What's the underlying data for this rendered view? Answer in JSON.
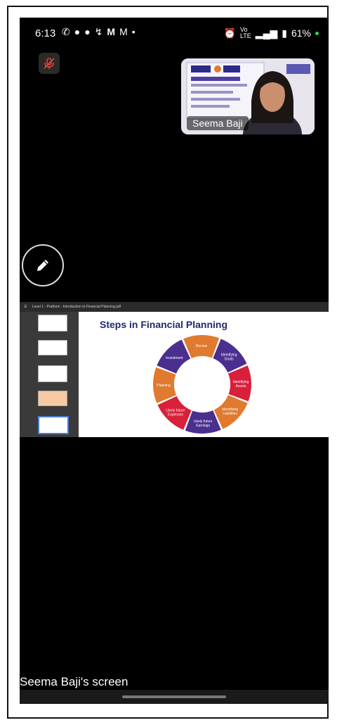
{
  "status_bar": {
    "time": "6:13",
    "right_text": "61%",
    "notif_icons": [
      "whatsapp-icon",
      "chat-icon",
      "chat-alt-icon",
      "lightning-icon",
      "m-icon",
      "gmail-icon",
      "dot-icon"
    ],
    "right_icons": [
      "alarm-icon",
      "volte-icon",
      "signal-5g-icon",
      "battery-icon"
    ]
  },
  "participant": {
    "name": "Seema Baji"
  },
  "share": {
    "label": "Seema Baji's screen",
    "window_title": "Level 1 - Prathom - Introduction to Financial Planning.pdf",
    "slide_title": "Steps in Financial Planning",
    "pieces": [
      "Review",
      "Identifying Goals",
      "Identifying Assets",
      "Identifying Liabilities",
      "Likely future Earnings",
      "Likely future Expenses",
      "Planning",
      "Investment"
    ],
    "piece_colors": [
      "#e07a2e",
      "#4b2f8f",
      "#d8203a",
      "#e07a2e",
      "#4b2f8f",
      "#d8203a",
      "#e07a2e",
      "#4b2f8f"
    ]
  }
}
